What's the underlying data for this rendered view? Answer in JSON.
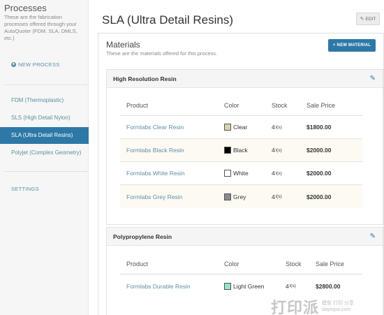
{
  "sidebar": {
    "title": "Processes",
    "description": "These are the fabrication processes offered through your AutoQuoter (FDM, SLA, DMLS, etc.)",
    "new_process": "NEW PROCESS",
    "items": [
      {
        "label": "FDM (Thermoplastic)",
        "active": false
      },
      {
        "label": "SLS (High Detail Nylon)",
        "active": false
      },
      {
        "label": "SLA (Ultra Detail Resins)",
        "active": true
      },
      {
        "label": "Polyjet (Complex Geometry)",
        "active": false
      }
    ],
    "settings": "SETTINGS"
  },
  "header": {
    "title": "SLA (Ultra Detail Resins)",
    "edit_label": "EDIT"
  },
  "materials": {
    "title": "Materials",
    "description": "These are the materials offered for this process.",
    "new_material": "NEW MATERIAL",
    "columns": [
      "Product",
      "Color",
      "Stock",
      "Sale Price"
    ],
    "groups": [
      {
        "name": "High Resolution Resin",
        "rows": [
          {
            "product": "Formlabs Clear Resin",
            "color": "Clear",
            "swatch": "#d9d2b0",
            "stock": "4",
            "unit": "l(s)",
            "price": "$1800.00"
          },
          {
            "product": "Formlabs Black Resin",
            "color": "Black",
            "swatch": "#000000",
            "stock": "4",
            "unit": "l(s)",
            "price": "$2000.00"
          },
          {
            "product": "Formlabs White Resin",
            "color": "White",
            "swatch": "#ffffff",
            "stock": "4",
            "unit": "l(s)",
            "price": "$2000.00"
          },
          {
            "product": "Formlabs Grey Resin",
            "color": "Grey",
            "swatch": "#8a8a8a",
            "stock": "4",
            "unit": "l(s)",
            "price": "$2000.00"
          }
        ]
      },
      {
        "name": "Polypropylene Resin",
        "rows": [
          {
            "product": "Formlabs Durable Resin",
            "color": "Light Green",
            "swatch": "#8fe8c8",
            "stock": "4",
            "unit": "l(s)",
            "price": "$2800.00"
          }
        ]
      }
    ]
  },
  "watermark": {
    "big": "打印派",
    "line1": "模型 打印 分享",
    "line2": "dayinpai.com"
  },
  "colors": {
    "accent": "#2e78a7",
    "link": "#5a8fa3"
  }
}
